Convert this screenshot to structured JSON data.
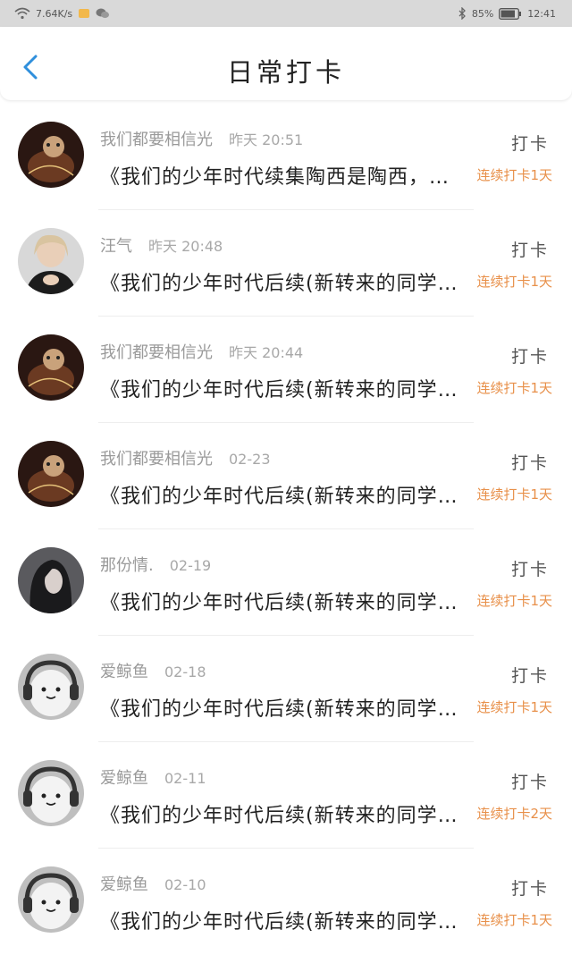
{
  "status_bar": {
    "speed": "7.64K/s",
    "battery": "85%",
    "time": "12:41"
  },
  "header": {
    "title": "日常打卡"
  },
  "colors": {
    "accent": "#2f8fdc",
    "streak": "#e8904a"
  },
  "items": [
    {
      "name": "我们都要相信光",
      "time": "昨天 20:51",
      "content": "《我们的少年时代续集陶西是陶西，唐冬是唐冬",
      "action": "打卡",
      "streak": "连续打卡1天",
      "avatar": "cat-photo"
    },
    {
      "name": "汪气",
      "time": "昨天 20:48",
      "content": "《我们的少年时代后续(新转来的同学)》",
      "action": "打卡",
      "streak": "连续打卡1天",
      "avatar": "girl-photo"
    },
    {
      "name": "我们都要相信光",
      "time": "昨天 20:44",
      "content": "《我们的少年时代后续(新转来的同学)》",
      "action": "打卡",
      "streak": "连续打卡1天",
      "avatar": "cat-photo"
    },
    {
      "name": "我们都要相信光",
      "time": "02-23",
      "content": "《我们的少年时代后续(新转来的同学)》",
      "action": "打卡",
      "streak": "连续打卡1天",
      "avatar": "cat-photo"
    },
    {
      "name": "那份情.",
      "time": "02-19",
      "content": "《我们的少年时代后续(新转来的同学)》",
      "action": "打卡",
      "streak": "连续打卡1天",
      "avatar": "dark-hair-photo"
    },
    {
      "name": "爱鲸鱼",
      "time": "02-18",
      "content": "《我们的少年时代后续(新转来的同学)》",
      "action": "打卡",
      "streak": "连续打卡1天",
      "avatar": "cartoon-headphones"
    },
    {
      "name": "爱鲸鱼",
      "time": "02-11",
      "content": "《我们的少年时代后续(新转来的同学)》",
      "action": "打卡",
      "streak": "连续打卡2天",
      "avatar": "cartoon-headphones"
    },
    {
      "name": "爱鲸鱼",
      "time": "02-10",
      "content": "《我们的少年时代后续(新转来的同学)》",
      "action": "打卡",
      "streak": "连续打卡1天",
      "avatar": "cartoon-headphones"
    }
  ]
}
